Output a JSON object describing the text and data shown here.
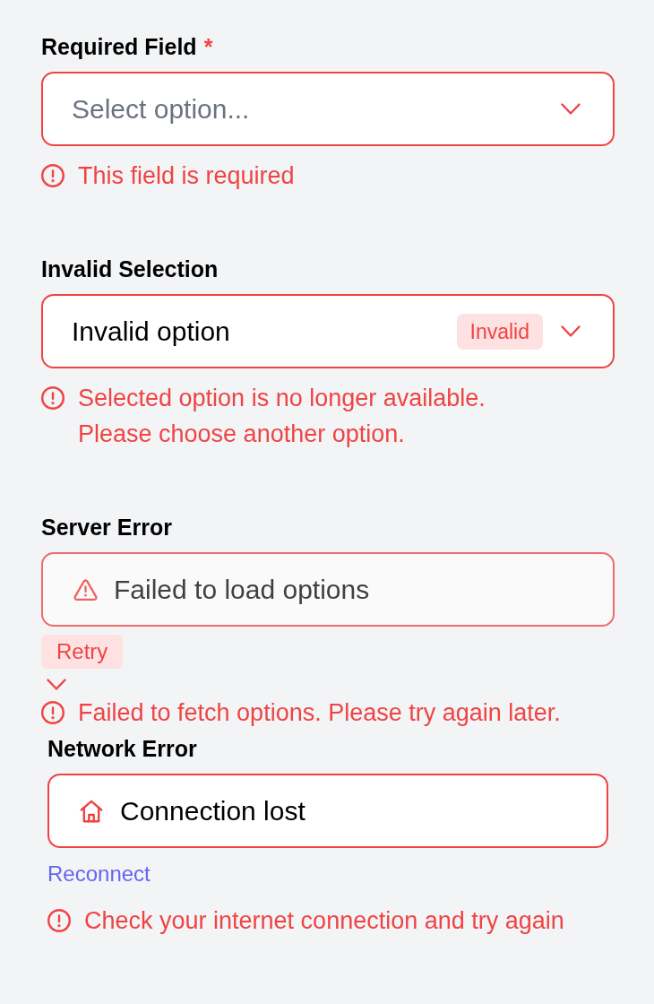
{
  "fields": [
    {
      "kind": "select",
      "label": "Required Field",
      "required_mark": "*",
      "placeholder": "Select option...",
      "error": "This field is required"
    },
    {
      "kind": "select",
      "label": "Invalid Selection",
      "value": "Invalid option",
      "badge": "Invalid",
      "error": "Selected option is no longer available.\nPlease choose another option."
    },
    {
      "kind": "load_error",
      "label": "Server Error",
      "message": "Failed to load options",
      "action": "Retry",
      "error": "Failed to fetch options. Please try again later."
    },
    {
      "kind": "offline",
      "label": "Network Error",
      "message": "Connection lost",
      "action": "Reconnect",
      "error": "Check your internet connection and try again"
    }
  ]
}
